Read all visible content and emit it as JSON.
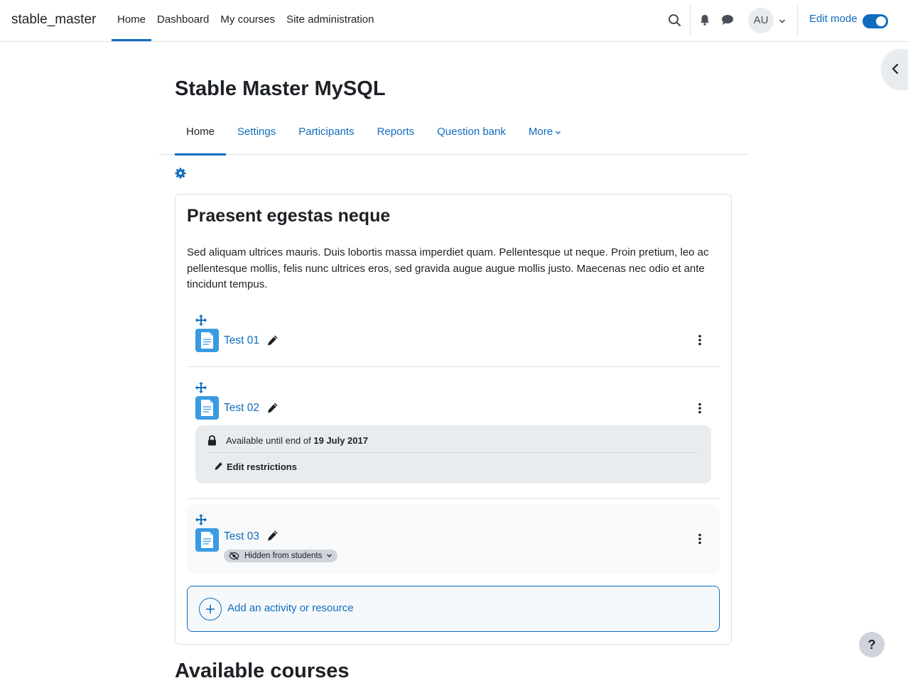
{
  "navbar": {
    "brand": "stable_master",
    "items": [
      {
        "label": "Home",
        "active": true
      },
      {
        "label": "Dashboard",
        "active": false
      },
      {
        "label": "My courses",
        "active": false
      },
      {
        "label": "Site administration",
        "active": false
      }
    ],
    "user_initials": "AU",
    "edit_mode_label": "Edit mode",
    "edit_mode_on": true
  },
  "page": {
    "title": "Stable Master MySQL",
    "tabs": [
      {
        "label": "Home",
        "active": true
      },
      {
        "label": "Settings",
        "active": false
      },
      {
        "label": "Participants",
        "active": false
      },
      {
        "label": "Reports",
        "active": false
      },
      {
        "label": "Question bank",
        "active": false
      },
      {
        "label": "More",
        "active": false
      }
    ]
  },
  "section": {
    "title": "Praesent egestas neque",
    "summary": "Sed aliquam ultrices mauris. Duis lobortis massa imperdiet quam. Pellentesque ut neque. Proin pretium, leo ac pellentesque mollis, felis nunc ultrices eros, sed gravida augue augue mollis justo. Maecenas nec odio et ante tincidunt tempus.",
    "activities": [
      {
        "name": "Test 01"
      },
      {
        "name": "Test 02",
        "restriction": {
          "prefix": "Available until end of ",
          "date": "19 July 2017",
          "edit_label": "Edit restrictions"
        }
      },
      {
        "name": "Test 03",
        "badge": "Hidden from students"
      }
    ],
    "add_label": "Add an activity or resource"
  },
  "next_heading": "Available courses",
  "help_label": "?",
  "colors": {
    "primary": "#0f6cbf",
    "activity_icon": "#399be2",
    "text": "#1d2125",
    "border": "#dee2e6"
  }
}
